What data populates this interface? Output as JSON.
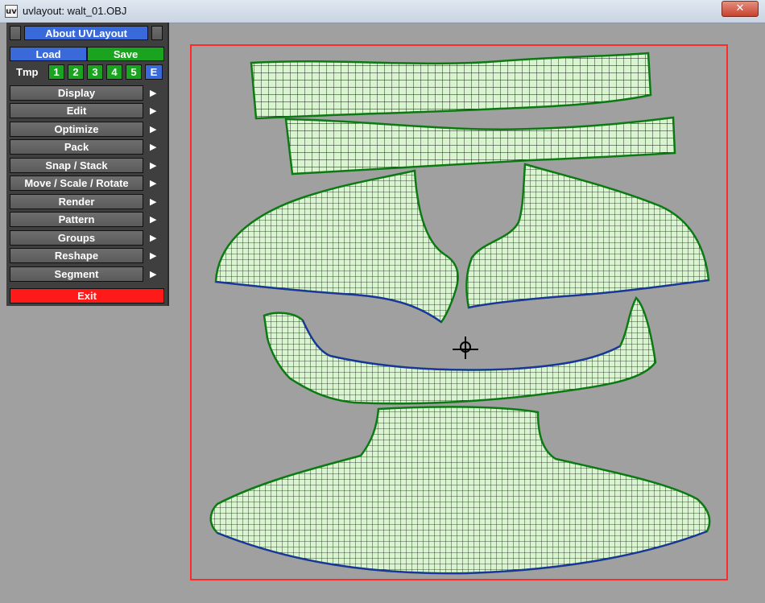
{
  "window": {
    "title": "uvlayout: walt_01.OBJ",
    "app_icon": "uv",
    "close_glyph": "✕"
  },
  "panel": {
    "about_label": "About UVLayout",
    "load_label": "Load",
    "save_label": "Save",
    "tmp_label": "Tmp",
    "tmp_slots": [
      "1",
      "2",
      "3",
      "4",
      "5",
      "E"
    ],
    "menu": [
      "Display",
      "Edit",
      "Optimize",
      "Pack",
      "Snap / Stack",
      "Move / Scale / Rotate",
      "Render",
      "Pattern",
      "Groups",
      "Reshape",
      "Segment"
    ],
    "exit_label": "Exit"
  },
  "colors": {
    "background": "#a0a0a0",
    "uv_fill": "#d8f5cf",
    "uv_edge": "#0b7a12",
    "uv_seam": "#1d32a6",
    "frame": "#ff2b2b"
  }
}
